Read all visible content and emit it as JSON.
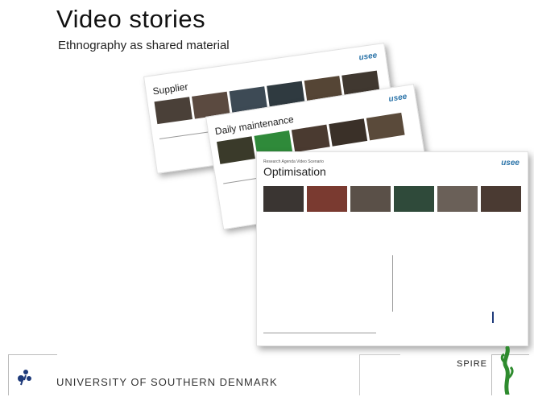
{
  "slide": {
    "title": "Video stories",
    "subtitle": "Ethnography as shared material"
  },
  "sheets": [
    {
      "label": "Supplier",
      "thumb_count": 7
    },
    {
      "label": "Daily maintenance",
      "thumb_count": 7
    },
    {
      "supertitle": "Research Agenda Video Scenario",
      "label": "Optimisation",
      "logo": "usee",
      "captions": [
        "",
        "",
        "",
        "",
        "",
        ""
      ],
      "thumb_count": 6
    }
  ],
  "footer": {
    "university": "UNIVERSITY OF SOUTHERN DENMARK",
    "brand": "SPIRE"
  },
  "colors": {
    "accent_blue": "#2a73a8",
    "navy": "#1e3a7a",
    "green": "#2e8b2e"
  }
}
